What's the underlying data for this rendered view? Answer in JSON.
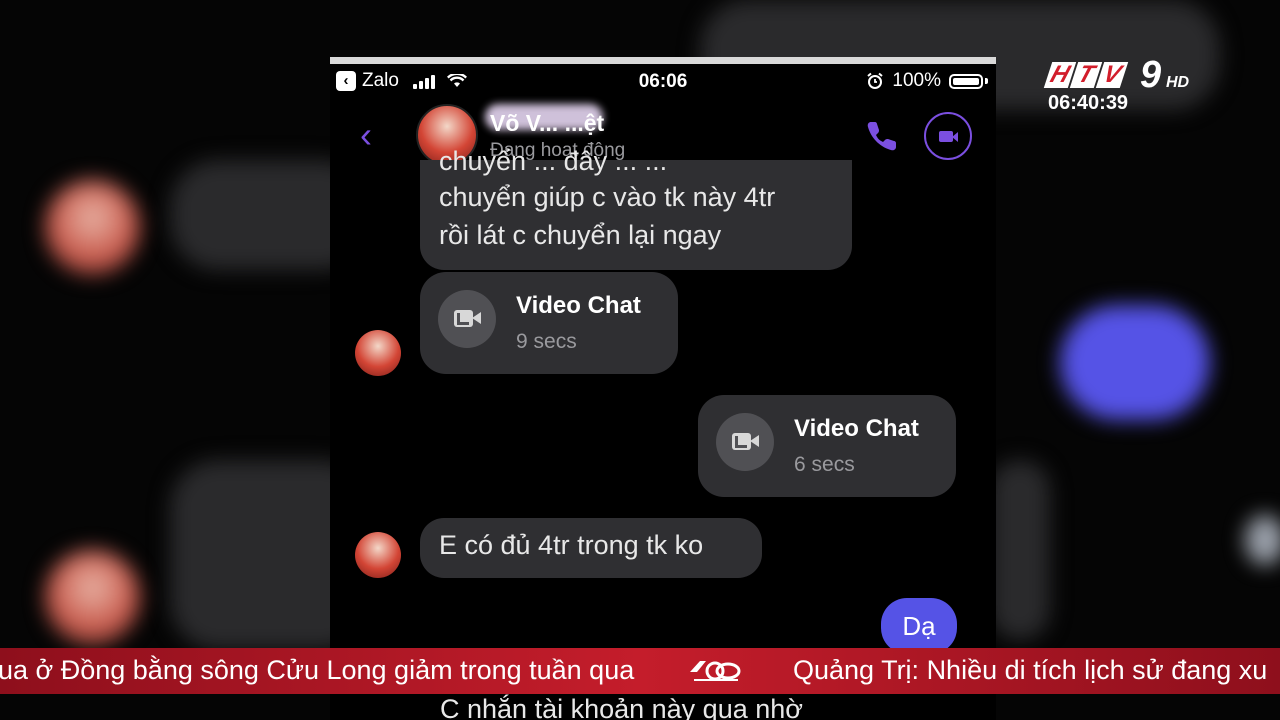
{
  "overlay": {
    "logo_text": "HTV9HD",
    "clock": "06:40:39"
  },
  "status_bar": {
    "back_app": "Zalo",
    "time": "06:06",
    "battery": "100%"
  },
  "chat_header": {
    "contact_name": "Võ V... ...ệt",
    "status": "Đang hoạt động"
  },
  "messages": {
    "partial_top_line": "chuyển ... đây ... ...",
    "incoming_1": [
      "chuyển giúp c vào tk này 4tr",
      "rồi lát c chuyển lại ngay"
    ],
    "video_chat_1": {
      "title": "Video Chat",
      "duration": "9 secs"
    },
    "video_chat_2": {
      "title": "Video Chat",
      "duration": "6 secs"
    },
    "incoming_2": "E có đủ 4tr trong tk ko",
    "outgoing_1": "Dạ",
    "partial_bottom": "C nhắn tài khoản này qua nhờ"
  },
  "ticker": {
    "left_text": "ua ở Đồng bằng sông Cửu Long giảm trong tuần qua",
    "right_text": "Quảng Trị: Nhiều di tích lịch sử đang xu"
  },
  "colors": {
    "accent_purple": "#7b4fe0",
    "sent_bubble": "#5553e6",
    "received_bubble": "#2f2f32",
    "ticker_red": "#c41d2b"
  }
}
